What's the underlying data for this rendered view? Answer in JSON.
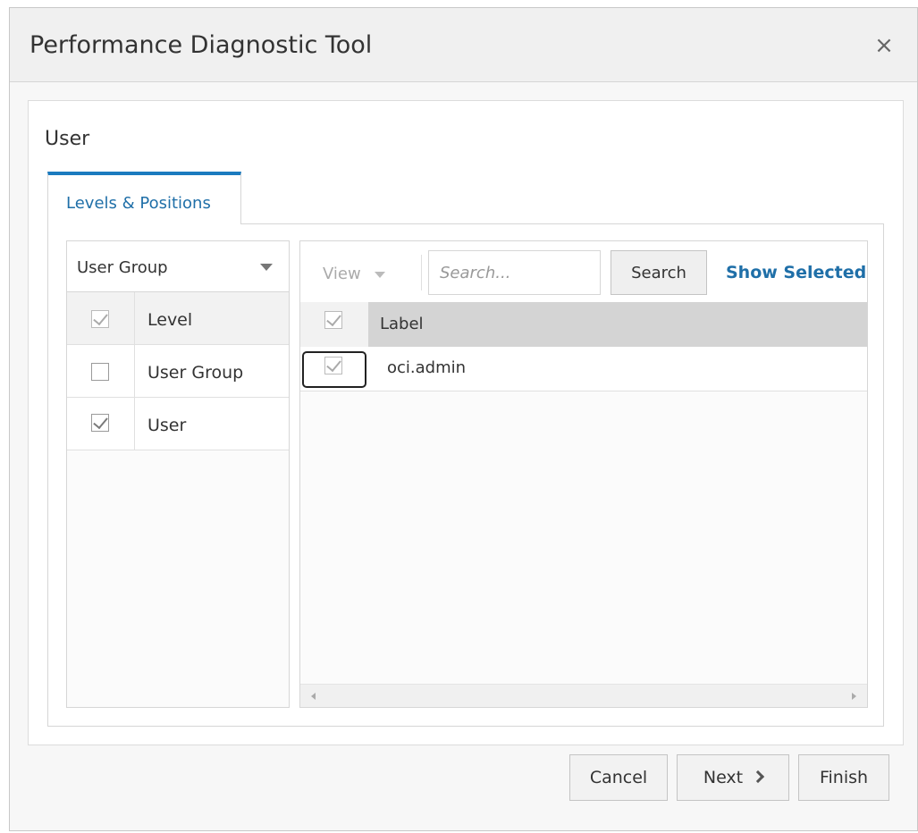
{
  "dialog": {
    "title": "Performance Diagnostic Tool",
    "close_icon": "×"
  },
  "section": {
    "title": "User"
  },
  "tabs": [
    {
      "label": "Levels & Positions",
      "active": true
    }
  ],
  "left_panel": {
    "select_value": "User Group",
    "rows": [
      {
        "label": "Level",
        "checked": true,
        "header": true
      },
      {
        "label": "User Group",
        "checked": false
      },
      {
        "label": "User",
        "checked": true
      }
    ]
  },
  "right_panel": {
    "view_label": "View",
    "search_placeholder": "Search...",
    "search_button": "Search",
    "show_selected": "Show Selected",
    "column_header": "Label",
    "rows": [
      {
        "label": "oci.admin",
        "checked": true
      }
    ]
  },
  "footer": {
    "cancel": "Cancel",
    "next": "Next",
    "finish": "Finish"
  },
  "colors": {
    "accent": "#1b7bbf",
    "link": "#1f6fa8"
  }
}
